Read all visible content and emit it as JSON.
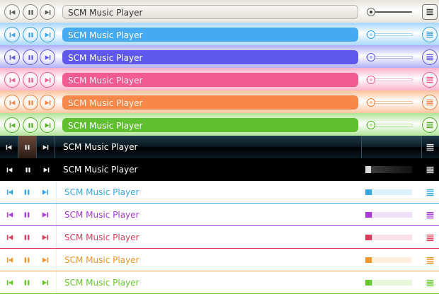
{
  "title_text": "SCM Music Player",
  "icons": {
    "prev": "skip-previous-icon",
    "pause": "pause-icon",
    "next": "skip-next-icon",
    "menu": "playlist-menu-icon"
  },
  "volume_level": 0.1,
  "skins": [
    {
      "name": "silver",
      "style": "glossy",
      "colors": {
        "bar": "#e7e4dd",
        "title_bg": "#ebe8e2",
        "title_text": "#333333",
        "btn": "#f4f3ef",
        "icon": "#444444"
      },
      "title": "SCM Music Player"
    },
    {
      "name": "blue",
      "style": "glossy",
      "colors": {
        "bar": "#a8d8fb",
        "title_bg": "#46aaf2",
        "title_text": "#ffffff",
        "btn": "#e8f5ff",
        "icon": "#3aa0ea"
      },
      "title": "SCM Music Player"
    },
    {
      "name": "purple",
      "style": "glossy",
      "colors": {
        "bar": "#b3b1f7",
        "title_bg": "#5f58ee",
        "title_text": "#ffffff",
        "btn": "#ececff",
        "icon": "#5e57e6"
      },
      "title": "SCM Music Player"
    },
    {
      "name": "pink",
      "style": "glossy",
      "colors": {
        "bar": "#fbb3cb",
        "title_bg": "#f25a92",
        "title_text": "#ffe8f0",
        "btn": "#fff0f5",
        "icon": "#ec5a8e"
      },
      "title": "SCM Music Player"
    },
    {
      "name": "orange",
      "style": "glossy",
      "colors": {
        "bar": "#fcc6a1",
        "title_bg": "#f7884a",
        "title_text": "#fff0e4",
        "btn": "#fff3ea",
        "icon": "#f08242"
      },
      "title": "SCM Music Player"
    },
    {
      "name": "green",
      "style": "glossy",
      "colors": {
        "bar": "#b4e59b",
        "title_bg": "#5fbf2f",
        "title_text": "#ffffff",
        "btn": "#f0fbe8",
        "icon": "#55b02c"
      },
      "title": "SCM Music Player"
    },
    {
      "name": "dark-glass",
      "style": "darkglass",
      "colors": {
        "bar": "#0d1a22",
        "title_text": "#ffffff",
        "icon": "#e8e8e8",
        "accent": "#3a2a22"
      },
      "title": "SCM Music Player"
    },
    {
      "name": "black",
      "style": "black",
      "colors": {
        "bar": "#000000",
        "title_text": "#ffffff",
        "icon": "#ffffff"
      },
      "title": "SCM Music Player"
    },
    {
      "name": "flat-blue",
      "style": "flat",
      "colors": {
        "line": "#3aa3da",
        "accent": "#35a8e4",
        "title_text": "#35a8e4",
        "track": "#ddf1fb"
      },
      "title": "SCM Music Player"
    },
    {
      "name": "flat-purple",
      "style": "flat",
      "colors": {
        "line": "#a63ddb",
        "accent": "#a73ad8",
        "title_text": "#a73ad8",
        "track": "#f1e2fa"
      },
      "title": "SCM Music Player"
    },
    {
      "name": "flat-red",
      "style": "flat",
      "colors": {
        "line": "#df3b5b",
        "accent": "#dd3b5a",
        "title_text": "#dd3b5a",
        "track": "#fbe1e7"
      },
      "title": "SCM Music Player"
    },
    {
      "name": "flat-orange",
      "style": "flat",
      "colors": {
        "line": "#ee9a2e",
        "accent": "#ee982c",
        "title_text": "#ee982c",
        "track": "#fdefdc"
      },
      "title": "SCM Music Player"
    },
    {
      "name": "flat-green",
      "style": "flat",
      "colors": {
        "line": "#68cc2c",
        "accent": "#66c82a",
        "title_text": "#66c82a",
        "track": "#e6f7dc"
      },
      "title": "SCM Music Player"
    }
  ]
}
